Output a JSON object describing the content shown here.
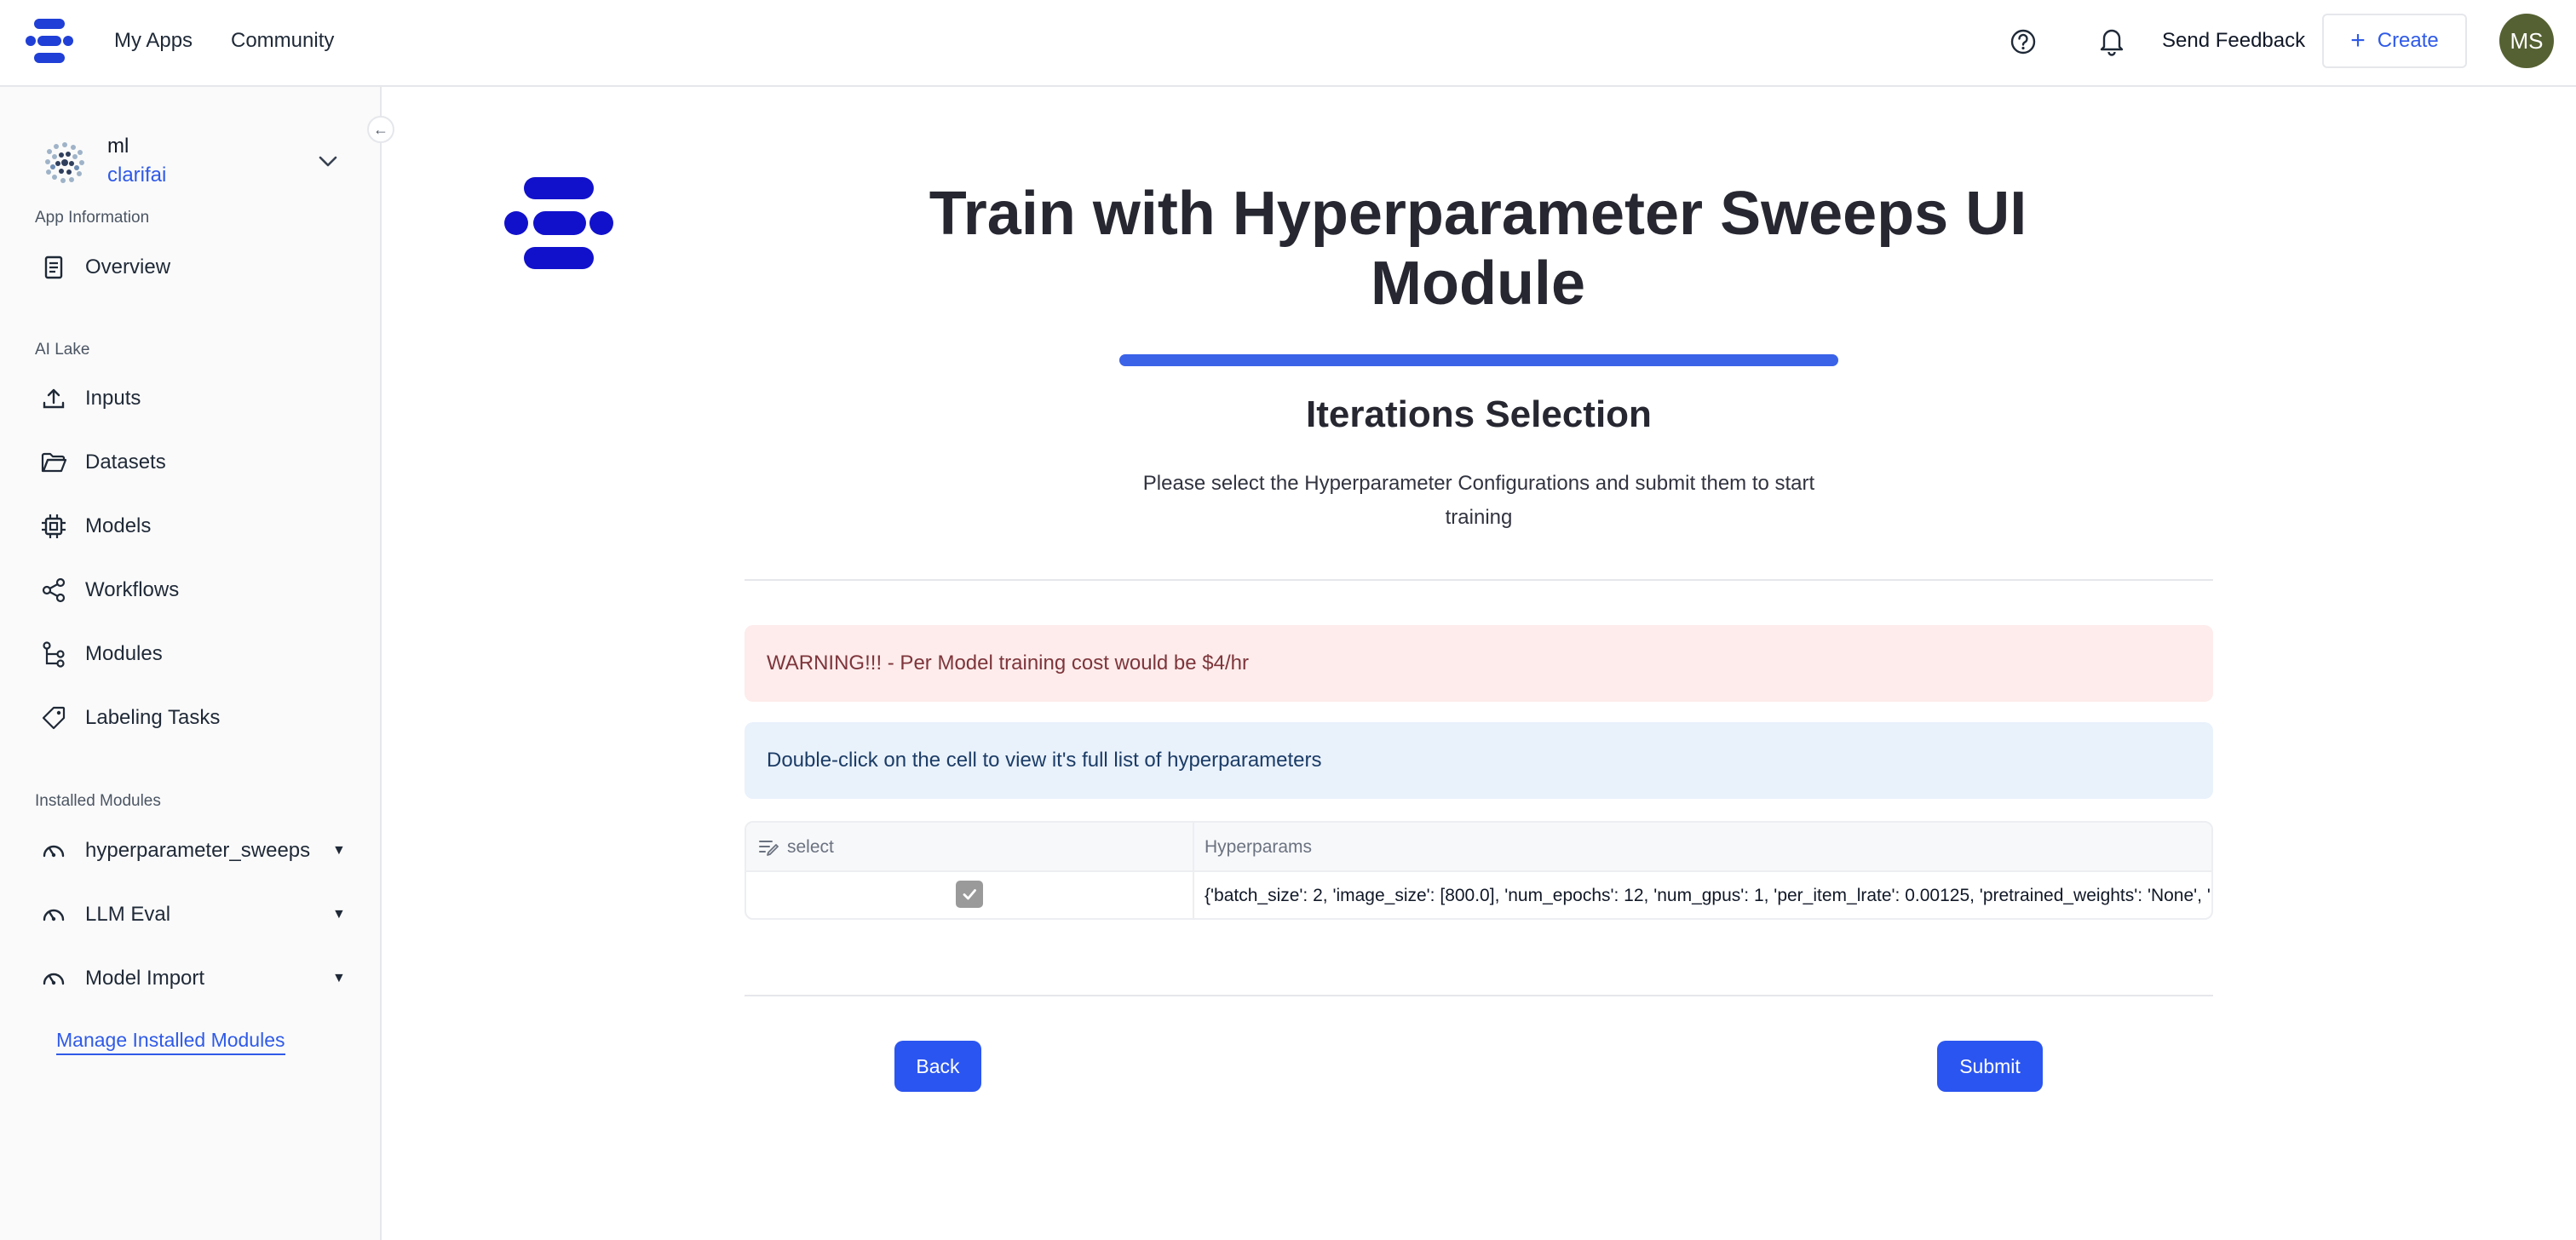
{
  "topbar": {
    "nav": {
      "my_apps": "My Apps",
      "community": "Community"
    },
    "send_feedback": "Send Feedback",
    "create_label": "Create",
    "avatar_initials": "MS",
    "icons": [
      "clarifai-logo-icon",
      "help-icon",
      "bell-icon",
      "plus-icon"
    ]
  },
  "sidebar": {
    "app": {
      "name": "ml",
      "org": "clarifai"
    },
    "sections": {
      "app_info": "App Information",
      "ai_lake": "AI Lake",
      "installed": "Installed Modules"
    },
    "items": [
      {
        "label": "Overview",
        "icon": "document-icon"
      },
      {
        "label": "Inputs",
        "icon": "upload-icon"
      },
      {
        "label": "Datasets",
        "icon": "folder-icon"
      },
      {
        "label": "Models",
        "icon": "chip-icon"
      },
      {
        "label": "Workflows",
        "icon": "share-nodes-icon"
      },
      {
        "label": "Modules",
        "icon": "branch-icon"
      },
      {
        "label": "Labeling Tasks",
        "icon": "tag-icon"
      }
    ],
    "modules": [
      {
        "label": "hyperparameter_sweeps",
        "icon": "gauge-icon"
      },
      {
        "label": "LLM Eval",
        "icon": "gauge-icon"
      },
      {
        "label": "Model Import",
        "icon": "gauge-icon"
      }
    ],
    "manage_label": "Manage Installed Modules"
  },
  "main": {
    "title": "Train with Hyperparameter Sweeps UI Module",
    "progress_fraction": 1.0,
    "step_title": "Iterations Selection",
    "step_description": "Please select the Hyperparameter Configurations and submit them to start training",
    "warning": "WARNING!!! - Per Model training cost would be $4/hr",
    "info": "Double-click on the cell to view it's full list of hyperparameters",
    "table": {
      "columns": [
        "select",
        "Hyperparams"
      ],
      "rows": [
        {
          "selected": true,
          "hyperparams": "{'batch_size': 2, 'image_size': [800.0], 'num_epochs': 12, 'num_gpus': 1, 'per_item_lrate': 0.00125, 'pretrained_weights': 'None', '"
        }
      ]
    },
    "buttons": {
      "back": "Back",
      "submit": "Submit"
    }
  },
  "colors": {
    "accent": "#2b55f0",
    "link": "#2f5ae8",
    "warning_bg": "#fdeceb",
    "info_bg": "#e9f1fb",
    "avatar_bg": "#556132"
  }
}
